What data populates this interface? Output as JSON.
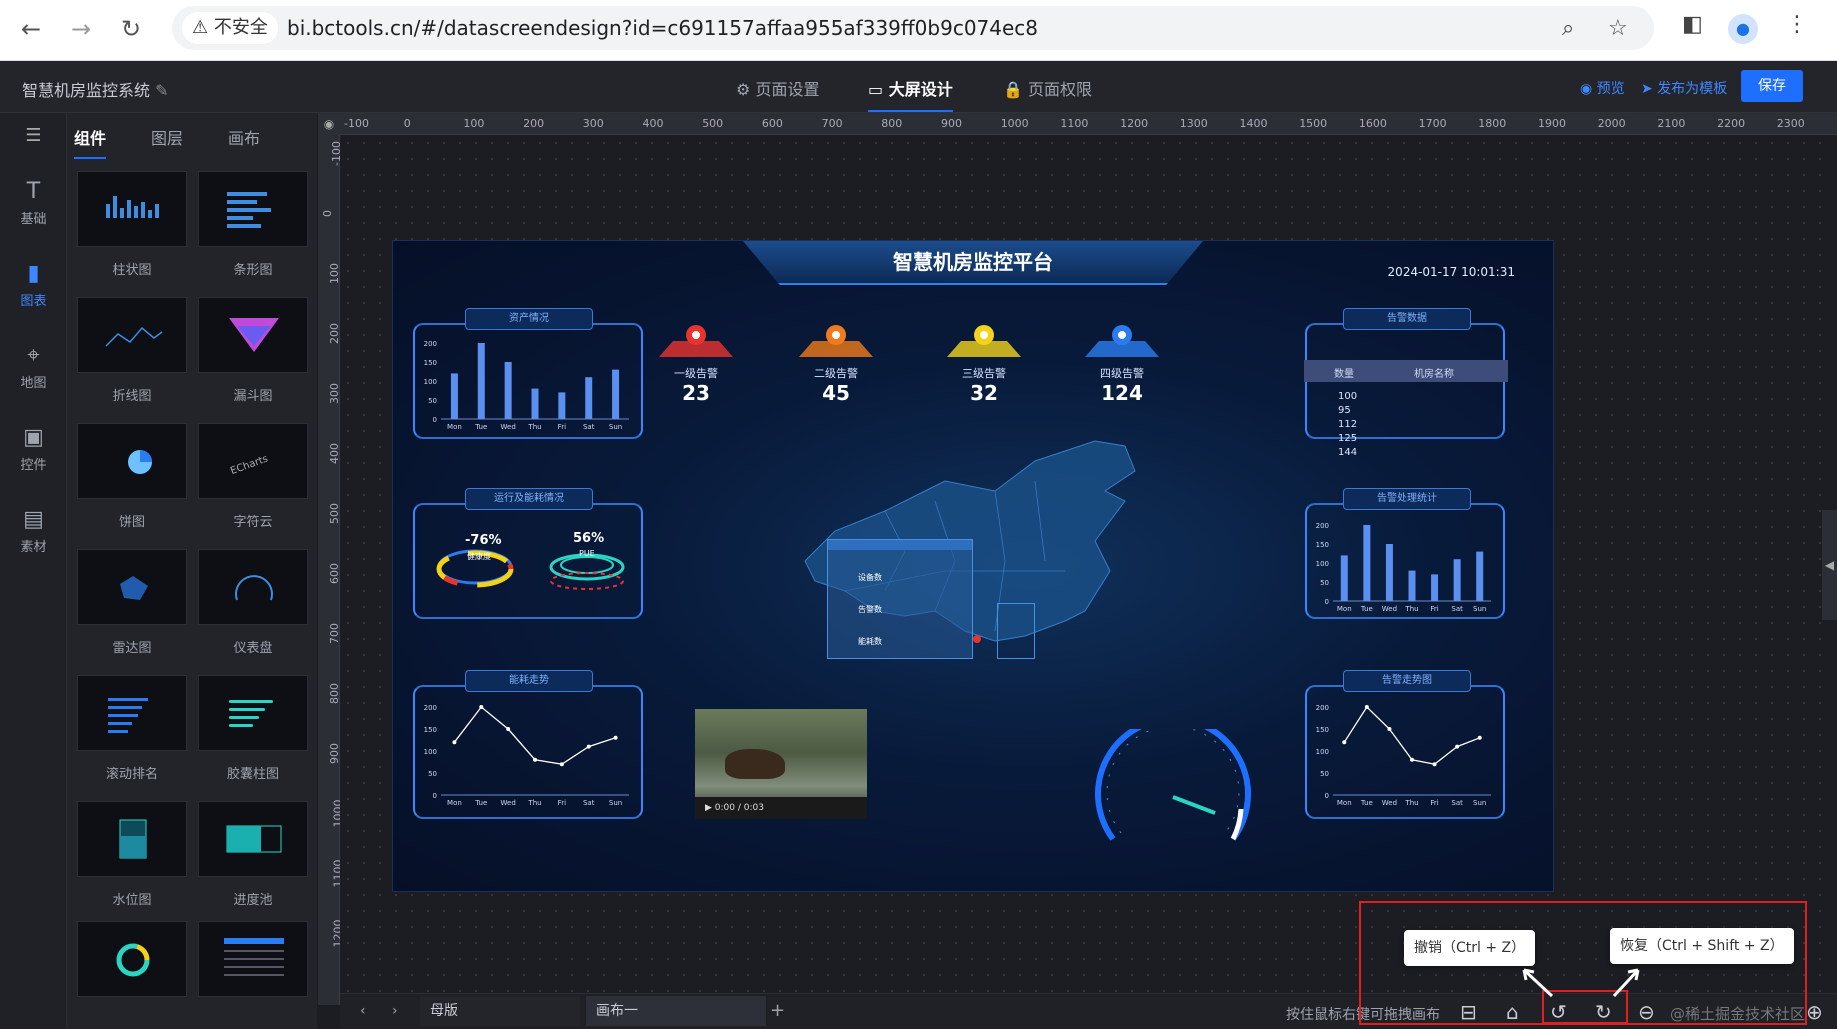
{
  "browser": {
    "security_label": "不安全",
    "url": "bi.bctools.cn/#/datascreendesign?id=c691157affaa955af339ff0b9c074ec8"
  },
  "topbar": {
    "project_name": "智慧机房监控系统",
    "tabs": [
      {
        "label": "页面设置",
        "icon": "gear-icon"
      },
      {
        "label": "大屏设计",
        "icon": "screen-icon"
      },
      {
        "label": "页面权限",
        "icon": "lock-icon"
      }
    ],
    "preview_label": "预览",
    "publish_label": "发布为模板",
    "save_label": "保存"
  },
  "sidebar": {
    "items": [
      {
        "label": "基础",
        "icon": "text-icon"
      },
      {
        "label": "图表",
        "icon": "chart-icon"
      },
      {
        "label": "地图",
        "icon": "map-pin-icon"
      },
      {
        "label": "控件",
        "icon": "control-icon"
      },
      {
        "label": "素材",
        "icon": "image-icon"
      }
    ]
  },
  "panel": {
    "tabs": [
      "组件",
      "图层",
      "画布"
    ],
    "components": [
      "柱状图",
      "条形图",
      "折线图",
      "漏斗图",
      "饼图",
      "字符云",
      "雷达图",
      "仪表盘",
      "滚动排名",
      "胶囊柱图",
      "水位图",
      "进度池"
    ]
  },
  "ruler": {
    "h_ticks": [
      "-100",
      "0",
      "100",
      "200",
      "300",
      "400",
      "500",
      "600",
      "700",
      "800",
      "900",
      "1000",
      "1100",
      "1200",
      "1300",
      "1400",
      "1500",
      "1600",
      "1700",
      "1800",
      "1900",
      "2000",
      "2100",
      "2200",
      "2300"
    ],
    "v_ticks": [
      "-100",
      "0",
      "100",
      "200",
      "300",
      "400",
      "500",
      "600",
      "700",
      "800",
      "900",
      "1000",
      "1100",
      "1200"
    ]
  },
  "screen": {
    "title": "智慧机房监控平台",
    "datetime": "2024-01-17 10:01:31",
    "widgets": {
      "asset": "资产情况",
      "ops": "运行及能耗情况",
      "energy": "能耗走势",
      "alarm_data": "告警数据",
      "alarm_stats": "告警处理统计",
      "alarm_trend": "告警走势图"
    },
    "alarms": [
      {
        "name": "一级告警",
        "value": "23",
        "color": "#e8332f"
      },
      {
        "name": "二级告警",
        "value": "45",
        "color": "#f07a1c"
      },
      {
        "name": "三级告警",
        "value": "32",
        "color": "#f2d21a"
      },
      {
        "name": "四级告警",
        "value": "124",
        "color": "#2a7cf0"
      }
    ],
    "gauges": [
      {
        "value": "-76%",
        "label": "健康度"
      },
      {
        "value": "56%",
        "label": "PUE"
      }
    ],
    "table": {
      "headers": [
        "数量",
        "机房名称"
      ],
      "rows": [
        "100",
        "95",
        "112",
        "125",
        "144"
      ]
    },
    "map_popup": [
      "设备数",
      "告警数",
      "能耗数"
    ],
    "video_time": "0:00 / 0:03"
  },
  "chart_data": [
    {
      "type": "bar",
      "categories": [
        "Mon",
        "Tue",
        "Wed",
        "Thu",
        "Fri",
        "Sat",
        "Sun"
      ],
      "values": [
        120,
        200,
        150,
        80,
        70,
        110,
        130
      ],
      "ylim": [
        0,
        200
      ],
      "yticks": [
        0,
        50,
        100,
        150,
        200
      ]
    },
    {
      "type": "line",
      "categories": [
        "Mon",
        "Tue",
        "Wed",
        "Thu",
        "Fri",
        "Sat",
        "Sun"
      ],
      "values": [
        120,
        200,
        150,
        80,
        70,
        110,
        130
      ],
      "ylim": [
        0,
        200
      ],
      "yticks": [
        0,
        50,
        100,
        150,
        200
      ]
    },
    {
      "type": "bar",
      "categories": [
        "Mon",
        "Tue",
        "Wed",
        "Thu",
        "Fri",
        "Sat",
        "Sun"
      ],
      "values": [
        120,
        200,
        150,
        80,
        70,
        110,
        130
      ],
      "ylim": [
        0,
        200
      ],
      "yticks": [
        0,
        50,
        100,
        150,
        200
      ]
    },
    {
      "type": "line",
      "categories": [
        "Mon",
        "Tue",
        "Wed",
        "Thu",
        "Fri",
        "Sat",
        "Sun"
      ],
      "values": [
        120,
        200,
        150,
        80,
        70,
        110,
        130
      ],
      "ylim": [
        0,
        200
      ],
      "yticks": [
        0,
        50,
        100,
        150,
        200
      ]
    }
  ],
  "bottombar": {
    "mother_label": "母版",
    "canvas_tab": "画布一",
    "hint": "按住鼠标右键可拖拽画布",
    "watermark": "@稀土掘金技术社区"
  },
  "tooltips": {
    "undo": "撤销（Ctrl + Z）",
    "redo": "恢复（Ctrl + Shift + Z）"
  }
}
